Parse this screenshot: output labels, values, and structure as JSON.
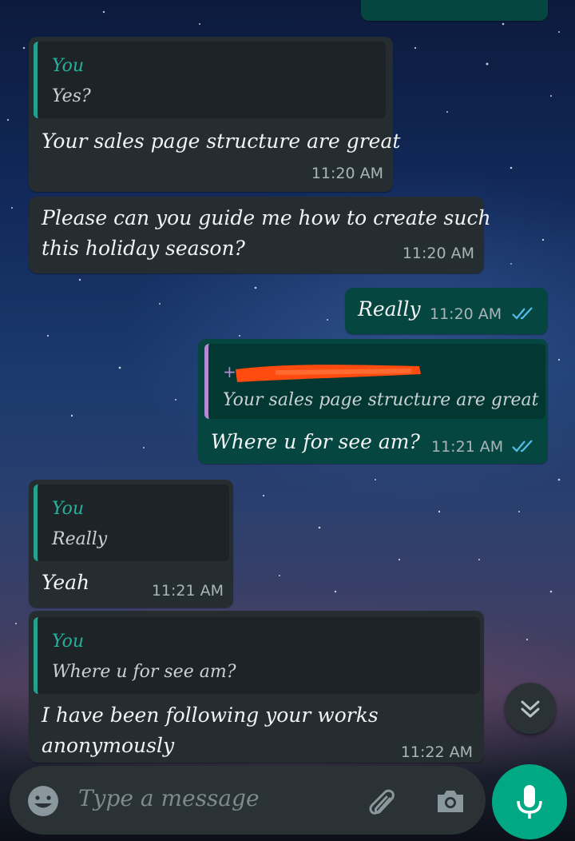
{
  "messages": [
    {
      "quote_author": "You",
      "quote_text": "Yes?",
      "text": "Your sales page structure are great",
      "time": "11:20 AM"
    },
    {
      "text_line1": "Please can you guide me how to create such",
      "text_line2": "this holiday season?",
      "time": "11:20 AM"
    },
    {
      "text": "Really",
      "time": "11:20 AM"
    },
    {
      "quote_text": "Your sales page structure are great",
      "text": "Where u for see am?",
      "time": "11:21 AM"
    },
    {
      "quote_author": "You",
      "quote_text": "Really",
      "text": "Yeah",
      "time": "11:21 AM"
    },
    {
      "quote_author": "You",
      "quote_text": "Where u for see am?",
      "text_line1": "I have been following your works",
      "text_line2": "anonymously",
      "time": "11:22 AM"
    }
  ],
  "composer": {
    "placeholder": "Type a message"
  },
  "icons": {
    "emoji": "emoji-icon",
    "attach": "paperclip-icon",
    "camera": "camera-icon",
    "mic": "mic-icon",
    "scroll_down": "double-chevron-down-icon",
    "read_ticks": "double-check-icon"
  },
  "colors": {
    "incoming": "#262d31",
    "outgoing": "#054740",
    "accent": "#00a884",
    "quote_author": "#25b19c",
    "read_ticks": "#53bdeb",
    "redaction": "#ff4a10"
  }
}
